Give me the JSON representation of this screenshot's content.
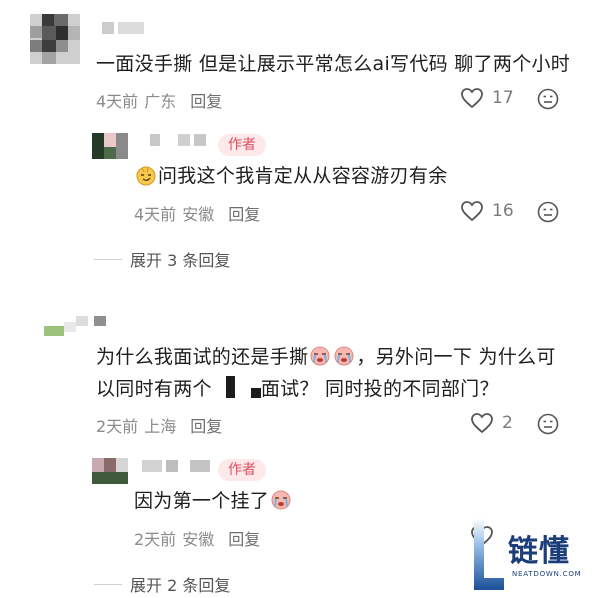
{
  "comments": [
    {
      "text": "一面没手撕 但是让展示平常怎么ai写代码 聊了两个小时",
      "time": "4天前",
      "location": "广东",
      "reply_label": "回复",
      "likes": "17",
      "reply": {
        "author_tag": "作者",
        "text": "问我这个我肯定从从容容游刃有余",
        "time": "4天前",
        "location": "安徽",
        "reply_label": "回复",
        "likes": "16"
      },
      "expand_label": "展开 3 条回复"
    },
    {
      "text_line1_a": "为什么我面试的还是手撕",
      "text_line1_b": "，另外问一下 为什么可",
      "text_line2_a": "以同时有两个",
      "text_line2_b": "面试？ 同时投的不同部门？",
      "time": "2天前",
      "location": "上海",
      "reply_label": "回复",
      "likes": "2",
      "reply": {
        "author_tag": "作者",
        "text": "因为第一个挂了",
        "time": "2天前",
        "location": "安徽",
        "reply_label": "回复"
      },
      "expand_label": "展开 2 条回复"
    }
  ],
  "watermark": {
    "brand": "链懂",
    "url": "NEATDOWN.COM"
  },
  "colors": {
    "author_tag_text": "#e0505e",
    "author_tag_bg": "#fde8ea",
    "meta_gray": "#8b8b8b",
    "watermark_blue": "#1b3d7a"
  }
}
